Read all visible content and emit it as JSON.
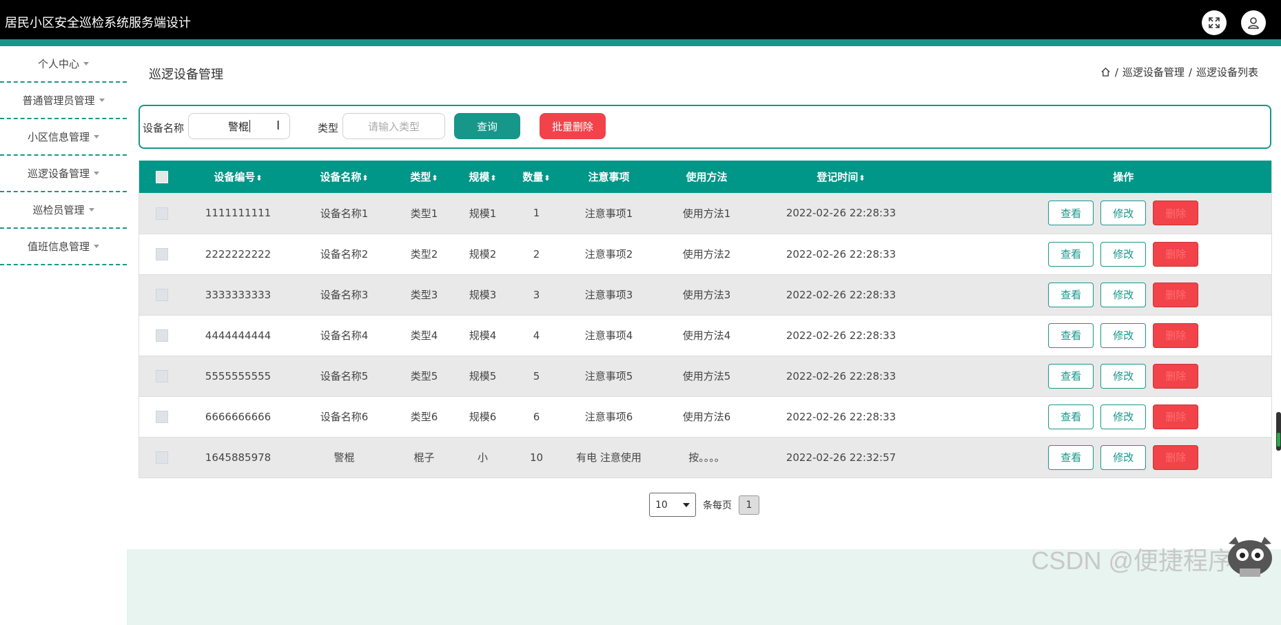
{
  "app": {
    "title": "居民小区安全巡检系统服务端设计"
  },
  "header": {
    "fullscreen_icon": "fullscreen-icon",
    "user_icon": "user-icon"
  },
  "sidebar": {
    "items": [
      {
        "label": "个人中心"
      },
      {
        "label": "普通管理员管理"
      },
      {
        "label": "小区信息管理"
      },
      {
        "label": "巡逻设备管理"
      },
      {
        "label": "巡检员管理"
      },
      {
        "label": "值班信息管理"
      }
    ]
  },
  "page": {
    "title": "巡逻设备管理",
    "breadcrumb": {
      "sep": "/",
      "level1": "巡逻设备管理",
      "level2": "巡逻设备列表"
    }
  },
  "search": {
    "name_label": "设备名称",
    "name_value": "警棍",
    "type_label": "类型",
    "type_placeholder": "请输入类型",
    "query_label": "查询",
    "bulk_delete_label": "批量删除"
  },
  "table": {
    "columns": [
      "设备编号",
      "设备名称",
      "类型",
      "规模",
      "数量",
      "注意事项",
      "使用方法",
      "登记时间",
      "操作"
    ],
    "sortable": [
      "设备编号",
      "设备名称",
      "类型",
      "规模",
      "数量",
      "登记时间"
    ],
    "actions": {
      "view": "查看",
      "edit": "修改",
      "delete": "删除"
    },
    "rows": [
      {
        "id": "1111111111",
        "name": "设备名称1",
        "type": "类型1",
        "scale": "规模1",
        "qty": "1",
        "notes": "注意事项1",
        "usage": "使用方法1",
        "time": "2022-02-26 22:28:33"
      },
      {
        "id": "2222222222",
        "name": "设备名称2",
        "type": "类型2",
        "scale": "规模2",
        "qty": "2",
        "notes": "注意事项2",
        "usage": "使用方法2",
        "time": "2022-02-26 22:28:33"
      },
      {
        "id": "3333333333",
        "name": "设备名称3",
        "type": "类型3",
        "scale": "规模3",
        "qty": "3",
        "notes": "注意事项3",
        "usage": "使用方法3",
        "time": "2022-02-26 22:28:33"
      },
      {
        "id": "4444444444",
        "name": "设备名称4",
        "type": "类型4",
        "scale": "规模4",
        "qty": "4",
        "notes": "注意事项4",
        "usage": "使用方法4",
        "time": "2022-02-26 22:28:33"
      },
      {
        "id": "5555555555",
        "name": "设备名称5",
        "type": "类型5",
        "scale": "规模5",
        "qty": "5",
        "notes": "注意事项5",
        "usage": "使用方法5",
        "time": "2022-02-26 22:28:33"
      },
      {
        "id": "6666666666",
        "name": "设备名称6",
        "type": "类型6",
        "scale": "规模6",
        "qty": "6",
        "notes": "注意事项6",
        "usage": "使用方法6",
        "time": "2022-02-26 22:28:33"
      },
      {
        "id": "1645885978",
        "name": "警棍",
        "type": "棍子",
        "scale": "小",
        "qty": "10",
        "notes": "有电 注意使用",
        "usage": "按。。。。",
        "time": "2022-02-26 22:32:57"
      }
    ]
  },
  "pagination": {
    "page_size": "10",
    "per_page_label": "条每页",
    "current_page": "1"
  },
  "watermark": "CSDN @便捷程序",
  "colors": {
    "primary": "#009688",
    "accent": "#17968a",
    "danger": "#f2424a",
    "header": "#000000"
  }
}
